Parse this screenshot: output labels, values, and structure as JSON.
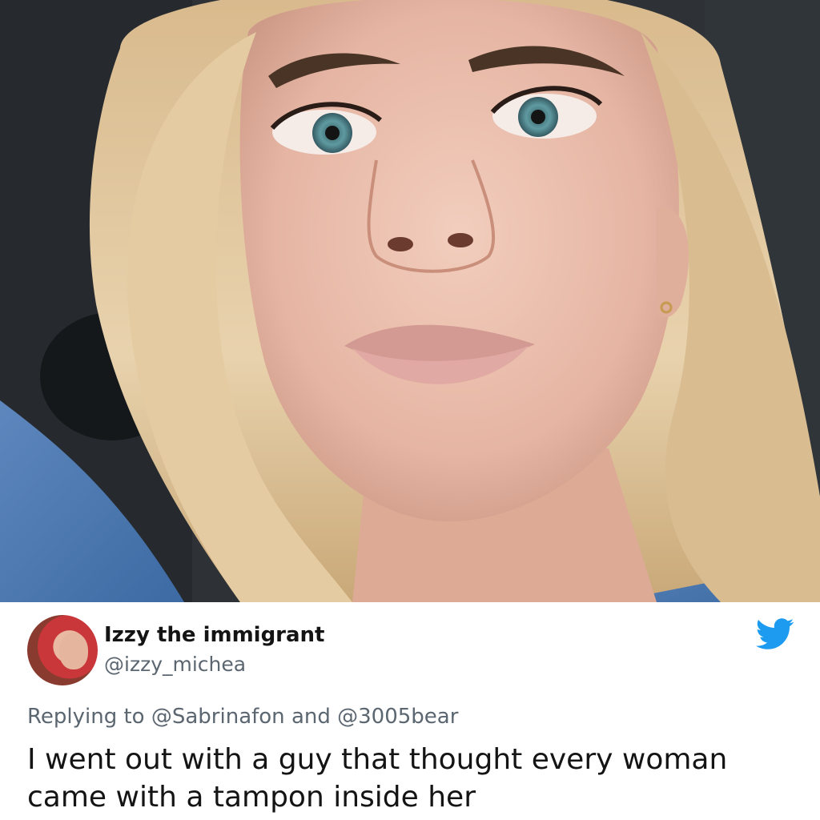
{
  "tweet": {
    "display_name": "Izzy the immigrant",
    "handle": "@izzy_michea",
    "reply_prefix": "Replying to",
    "reply_mention_1": "@Sabrinafon",
    "reply_joiner": "and",
    "reply_mention_2": "@3005bear",
    "text": "I went out with a guy that thought every woman came with a tampon inside her"
  },
  "icons": {
    "brand": "twitter-bird-icon",
    "brand_color": "#1d9bf0"
  }
}
